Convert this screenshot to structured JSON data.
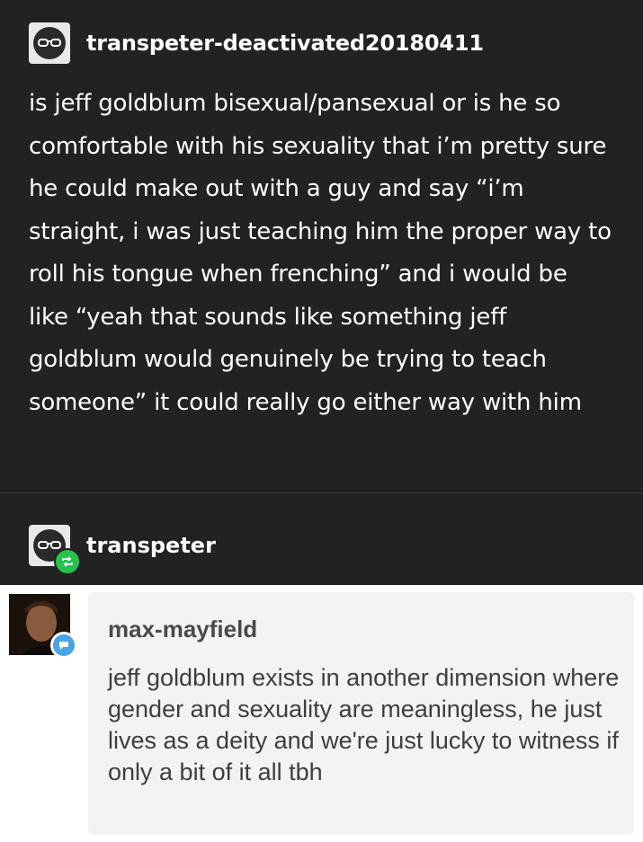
{
  "post": {
    "username": "transpeter-deactivated20180411",
    "avatar_icon": "sunglasses-face-icon",
    "body": "is jeff goldblum bisexual/pansexual or is he so comfortable with his sexuality that i’m pretty sure he could make out with a guy and say “i’m straight, i was just teaching him the proper way to roll his tongue when frenching” and i would be like “yeah that sounds like something jeff goldblum would genuinely be trying to teach someone” it could really go either way with him"
  },
  "reblog": {
    "username": "transpeter",
    "avatar_icon": "sunglasses-face-icon",
    "badge_icon": "reblog-icon",
    "badge_color": "#26c24e"
  },
  "message": {
    "sender": "max-mayfield",
    "badge_icon": "chat-bubble-icon",
    "badge_color": "#4aa3e6",
    "body": "jeff goldblum exists in another dimension where gender and sexuality are meaningless, he just lives as a deity and we're just lucky to witness if only a bit of it all tbh"
  }
}
